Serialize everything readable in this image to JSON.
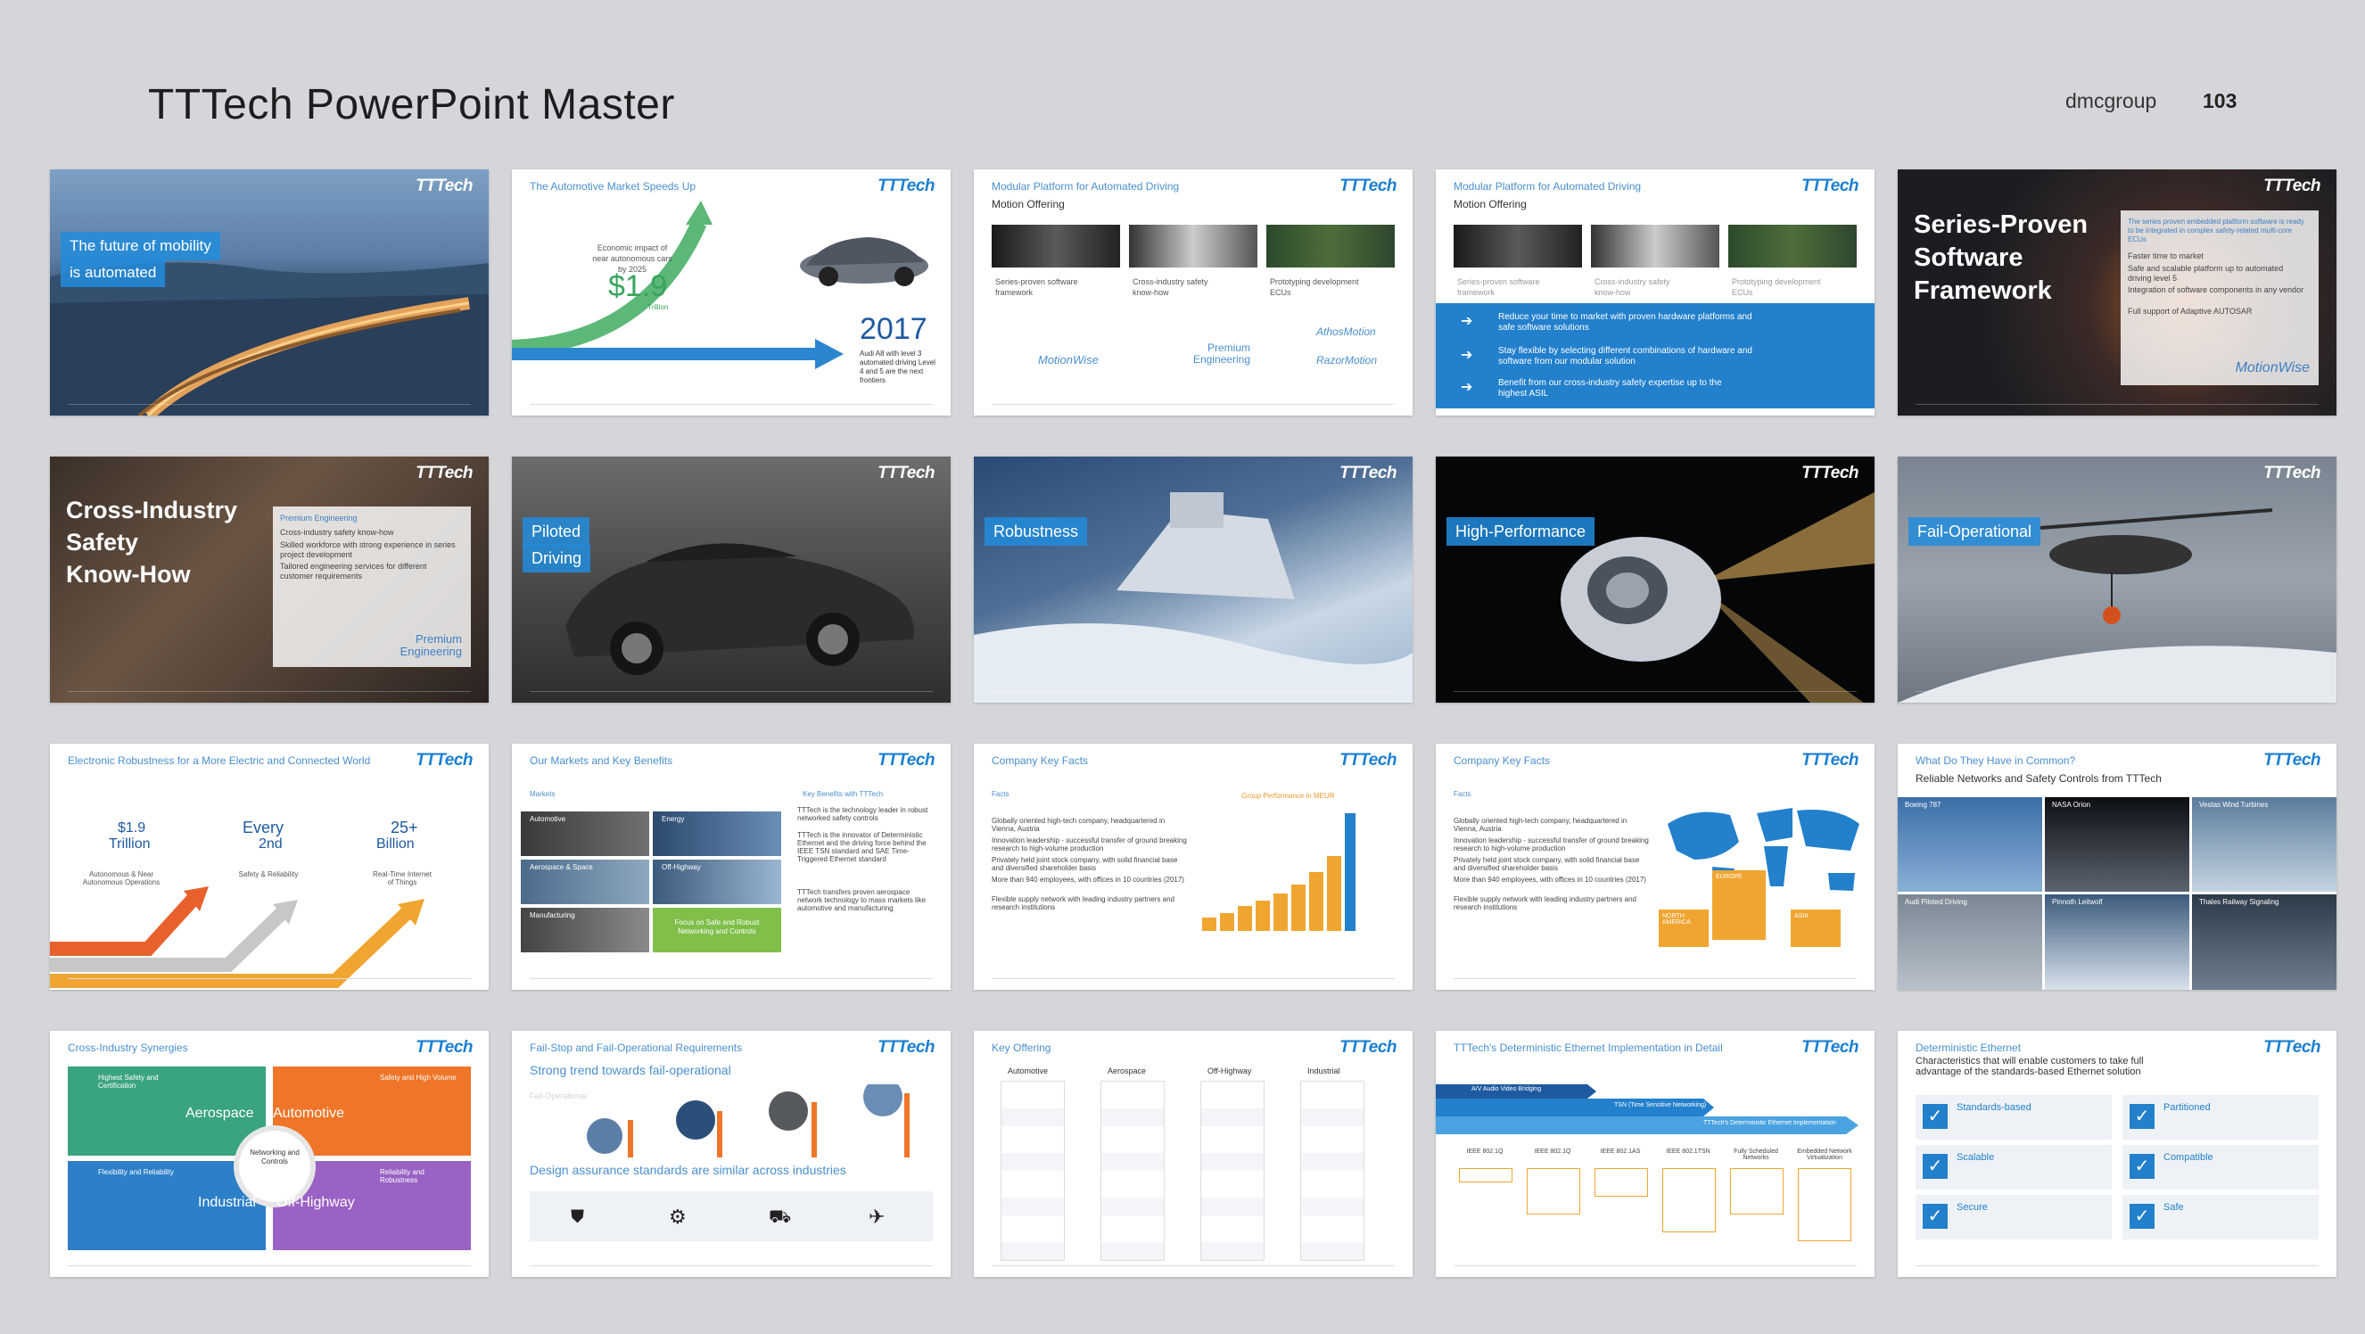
{
  "header": {
    "title": "TTTech PowerPoint Master",
    "brand": "dmcgroup",
    "page_number": "103"
  },
  "logo_text": "TTTech",
  "slides": {
    "s1": {
      "label_line1": "The future of mobility",
      "label_line2": "is automated"
    },
    "s2": {
      "title": "The Automotive Market Speeds Up",
      "impact_text": "Economic impact of near autonomous cars by 2025",
      "value": "$1.9",
      "value_unit": "Trillion",
      "year": "2017",
      "year_text": "Audi A8 with level 3 automated driving Level 4 and 5 are the next frontiers"
    },
    "s3": {
      "title": "Modular Platform for Automated Driving",
      "subtitle": "Motion Offering",
      "col1": "Series-proven software framework",
      "col2": "Cross-industry safety know-how",
      "col3": "Prototyping development ECUs",
      "brand1": "MotionWise",
      "brand2": "Premium Engineering",
      "brand3a": "AthosMotion",
      "brand3b": "RazorMotion"
    },
    "s4": {
      "title": "Modular Platform for Automated Driving",
      "subtitle": "Motion Offering",
      "col1": "Series-proven software framework",
      "col2": "Cross-industry safety know-how",
      "col3": "Prototyping development ECUs",
      "b1": "Reduce your time to market with proven hardware platforms and safe software solutions",
      "b2": "Stay flexible by selecting different combinations of hardware and software from our modular solution",
      "b3": "Benefit from our cross-industry safety expertise up to the highest ASIL"
    },
    "s5": {
      "line1": "Series-Proven",
      "line2": "Software",
      "line3": "Framework",
      "body": "The series proven embedded platform software is ready to be integrated in complex safety-related multi-core ECUs",
      "bul1": "Faster time to market",
      "bul2": "Safe and scalable platform up to automated driving level 5",
      "bul3": "Integration of software components in any vendor",
      "bul4": "Full support of Adaptive AUTOSAR",
      "brand": "MotionWise"
    },
    "s6": {
      "line1": "Cross-Industry",
      "line2": "Safety",
      "line3": "Know-How",
      "box_title": "Premium Engineering",
      "bul1": "Cross-industry safety know-how",
      "bul2": "Skilled workforce with strong experience in series project development",
      "bul3": "Tailored engineering services for different customer requirements",
      "brand": "Premium Engineering"
    },
    "s7": {
      "label_line1": "Piloted",
      "label_line2": "Driving"
    },
    "s8": {
      "label": "Robustness"
    },
    "s9": {
      "label": "High-Performance"
    },
    "s10": {
      "label": "Fail-Operational"
    },
    "s11": {
      "title": "Electronic Robustness for a More Electric and Connected World",
      "v1": "$1.9",
      "v1b": "Trillion",
      "v2": "Every",
      "v2b": "2nd",
      "v3": "25+",
      "v3b": "Billion",
      "c1": "Autonomous & Near Autonomous Operations",
      "c2": "Safety & Reliability",
      "c3": "Real-Time Internet of Things"
    },
    "s12": {
      "title": "Our Markets and Key Benefits",
      "markets": "Markets",
      "benefits": "Key Benefits with TTTech",
      "m1": "Automotive",
      "m2": "Energy",
      "m3": "Aerospace & Space",
      "m4": "Off-Highway",
      "m5": "Manufacturing",
      "green": "Focus on Safe and Robust Networking and Controls",
      "b1": "TTTech is the technology leader in robust networked safety controls",
      "b2": "TTTech is the innovator of Deterministic Ethernet and the driving force behind the IEEE TSN standard and SAE Time-Triggered Ethernet standard",
      "b3": "TTTech transfers proven aerospace network technology to mass markets like automotive and manufacturing"
    },
    "s13": {
      "title": "Company Key Facts",
      "facts": "Facts",
      "chart_title": "Group Performance in MEUR",
      "f1": "Globally oriented high-tech company, headquartered in Vienna, Austria",
      "f2": "Innovation leadership - successful transfer of ground breaking research to high-volume production",
      "f3": "Privately held joint stock company, with solid financial base and diversified shareholder basis",
      "f4": "More than 940 employees, with offices in 10 countries (2017)",
      "f5": "Flexible supply network with leading industry partners and research institutions"
    },
    "s14": {
      "title": "Company Key Facts",
      "facts": "Facts",
      "f1": "Globally oriented high-tech company, headquartered in Vienna, Austria",
      "f2": "Innovation leadership - successful transfer of ground breaking research to high-volume production",
      "f3": "Privately held joint stock company, with solid financial base and diversified shareholder basis",
      "f4": "More than 940 employees, with offices in 10 countries (2017)",
      "f5": "Flexible supply network with leading industry partners and research institutions",
      "r1": "EUROPE",
      "r2": "NORTH AMERICA",
      "r3": "ASIA"
    },
    "s15": {
      "title": "What Do They Have in Common?",
      "subtitle": "Reliable Networks and Safety Controls from TTTech",
      "p1": "Boeing 787",
      "p2": "NASA Orion",
      "p3": "Vestas Wind Turbines",
      "p4": "Audi Piloted Driving",
      "p5": "Pinnoth Leitwolf",
      "p6": "Thales Railway Signaling"
    },
    "s16": {
      "title": "Cross-Industry Synergies",
      "q1": "Aerospace",
      "q2": "Automotive",
      "q3": "Industrial",
      "q4": "Off-Highway",
      "center": "Networking and Controls",
      "t1": "Highest Safety and Certification",
      "t2": "Safety and High Volume",
      "t3": "Flexibility and Reliability",
      "t4": "Reliability and Robustness"
    },
    "s17": {
      "title": "Fail-Stop and Fail-Operational Requirements",
      "subtitle": "Strong trend towards fail-operational",
      "faint": "Fail-Operational",
      "bottom": "Design assurance standards are similar across industries"
    },
    "s18": {
      "title": "Key Offering",
      "c1": "Automotive",
      "c2": "Aerospace",
      "c3": "Off-Highway",
      "c4": "Industrial"
    },
    "s19": {
      "title": "TTTech's Deterministic Ethernet Implementation in Detail",
      "a1": "A/V Audio Video Bridging",
      "a2": "TSN (Time Sensitive Networking)",
      "a3": "TTTech's Deterministic Ethernet Implementation",
      "cols": [
        "IEEE 802.1Q",
        "IEEE 802.1Q",
        "IEEE 802.1AS",
        "IEEE 802.1TSN",
        "Fully Scheduled Networks",
        "Embedded Network Virtualization"
      ]
    },
    "s20": {
      "title": "Deterministic Ethernet",
      "subtitle": "Characteristics that will enable customers to take full advantage of the standards-based Ethernet solution",
      "k1": "Standards-based",
      "k2": "Partitioned",
      "k3": "Scalable",
      "k4": "Compatible",
      "k5": "Secure",
      "k6": "Safe"
    }
  }
}
